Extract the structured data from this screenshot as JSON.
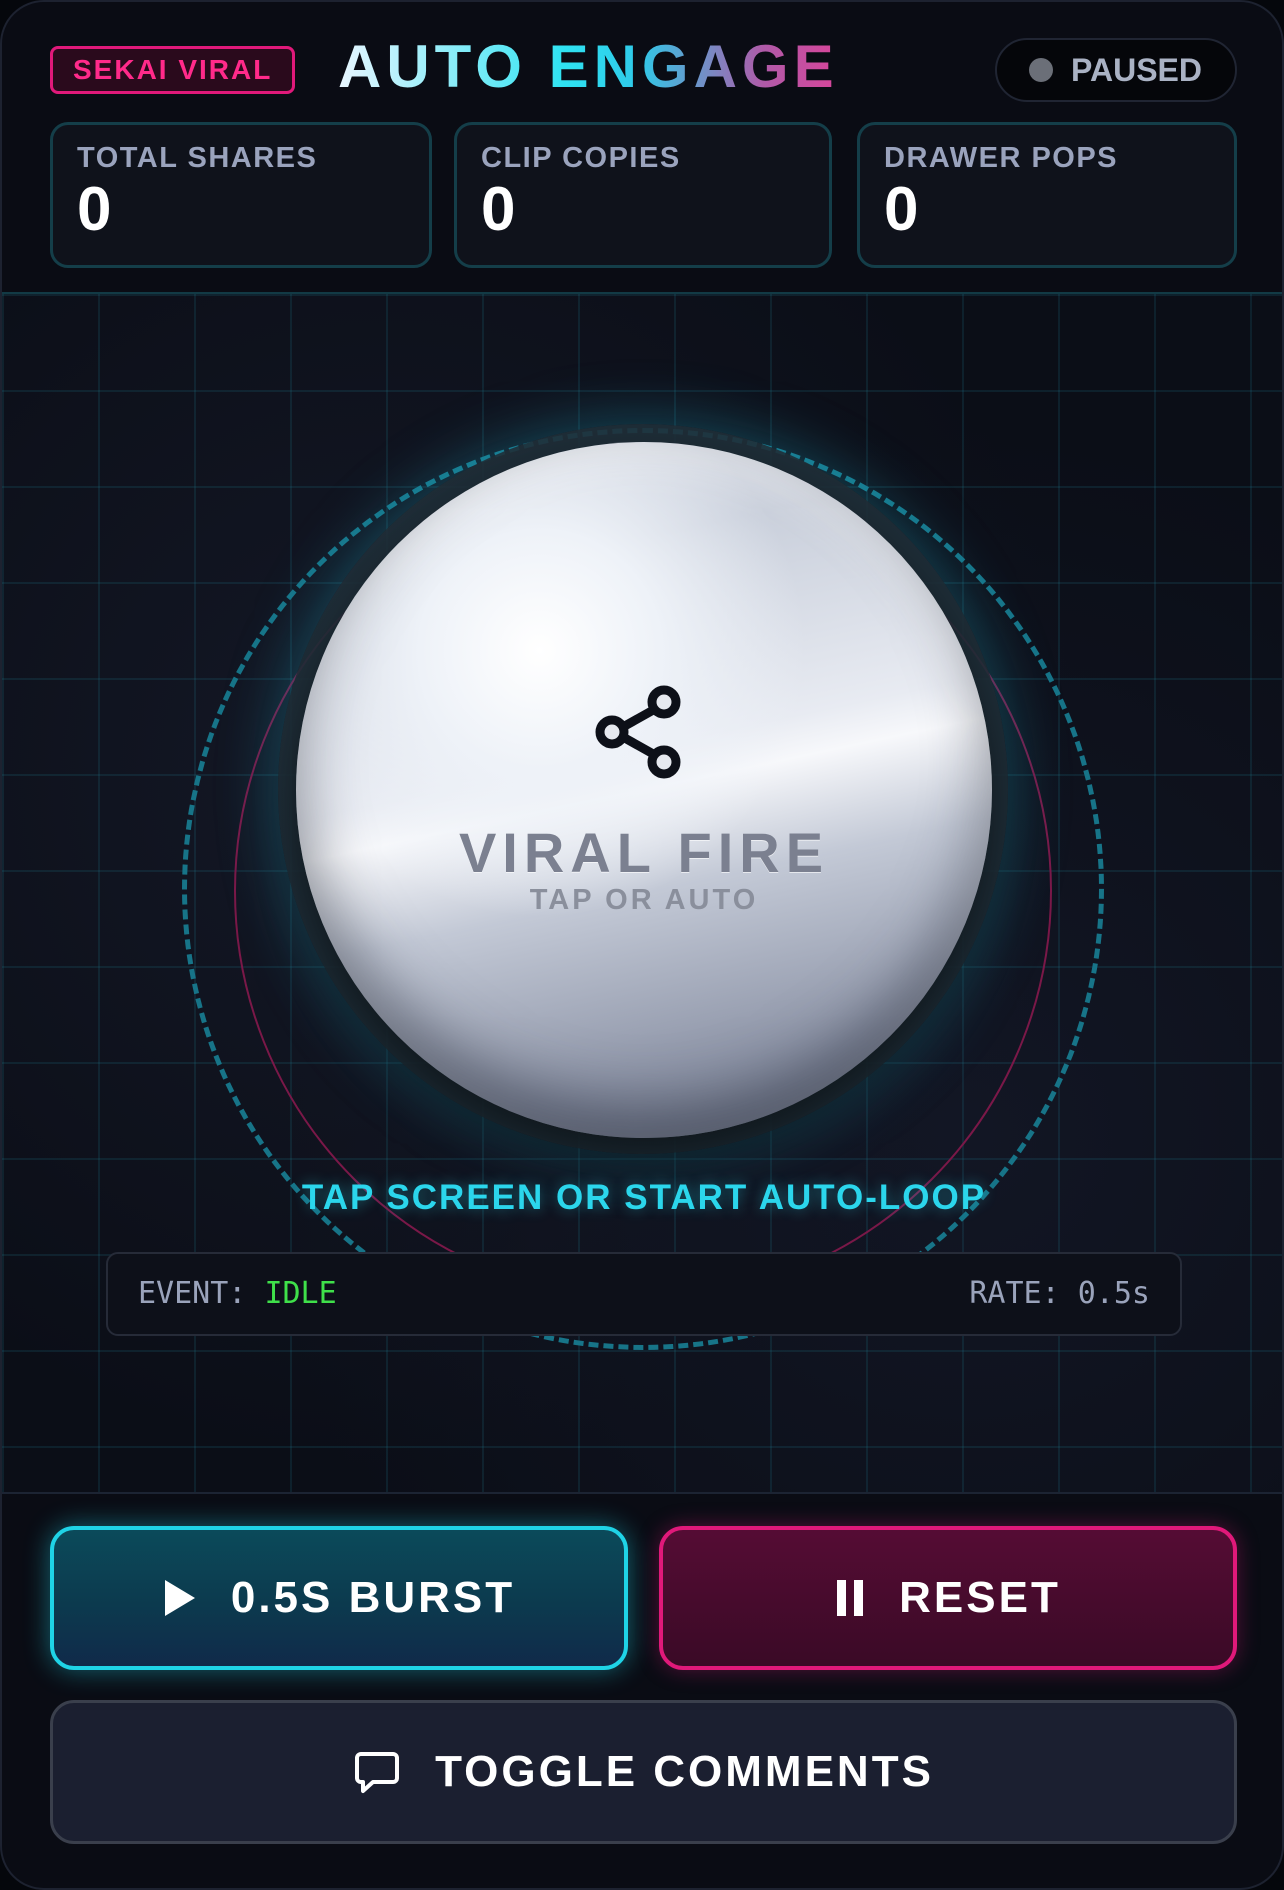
{
  "header": {
    "badge": "SEKAI VIRAL",
    "title": "AUTO ENGAGE",
    "status": "PAUSED"
  },
  "stats": [
    {
      "label": "TOTAL SHARES",
      "value": "0"
    },
    {
      "label": "CLIP COPIES",
      "value": "0"
    },
    {
      "label": "DRAWER POPS",
      "value": "0"
    }
  ],
  "orb": {
    "icon": "share-icon",
    "title": "VIRAL FIRE",
    "subtitle": "TAP OR AUTO"
  },
  "hint": "TAP SCREEN OR START AUTO-LOOP",
  "event_bar": {
    "event_label": "EVENT: ",
    "event_value": "IDLE",
    "rate_label": "RATE: 0.5s"
  },
  "buttons": {
    "burst": {
      "label": "0.5S BURST",
      "icon": "play-icon"
    },
    "reset": {
      "label": "RESET",
      "icon": "pause-icon"
    },
    "comments": {
      "label": "TOGGLE COMMENTS",
      "icon": "comment-icon"
    }
  },
  "colors": {
    "accent_cyan": "#1fd3e6",
    "accent_pink": "#e0197a",
    "idle_green": "#3fe04a"
  }
}
